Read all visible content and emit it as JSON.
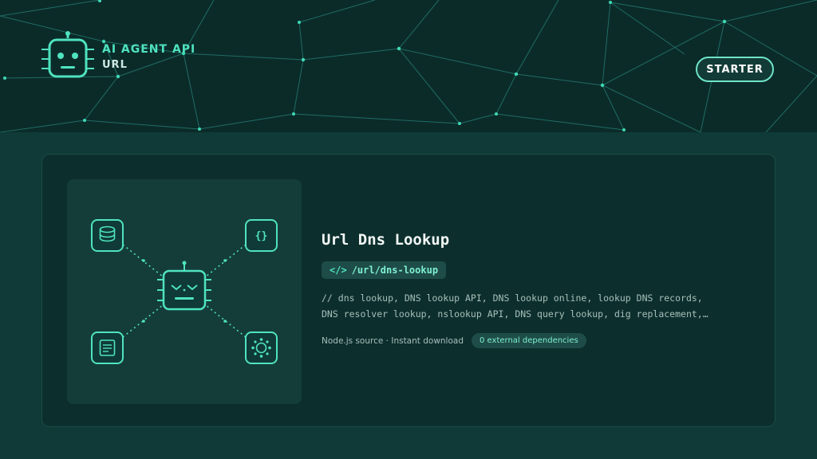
{
  "brand": {
    "title": "AI AGENT API",
    "subtitle": "URL",
    "icon": "robot-icon"
  },
  "header": {
    "button_label": "STARTER"
  },
  "tool": {
    "title": "Url Dns Lookup",
    "endpoint_icon": "</>",
    "endpoint": "/url/dns-lookup",
    "description": "// dns lookup, DNS lookup API, DNS lookup online, lookup DNS records, DNS resolver lookup, nslookup API, DNS query lookup, dig replacement,…",
    "meta": "Node.js source · Instant download",
    "dependencies": "0 external dependencies"
  },
  "illustration": {
    "nodes": [
      "database-icon",
      "json-icon",
      "document-icon",
      "network-icon"
    ],
    "center": "robot-icon"
  },
  "colors": {
    "accent": "#4fe3bf",
    "header_bg": "#0b2b29",
    "page_bg": "#0f3a37",
    "card_bg": "#0c2f2d"
  }
}
